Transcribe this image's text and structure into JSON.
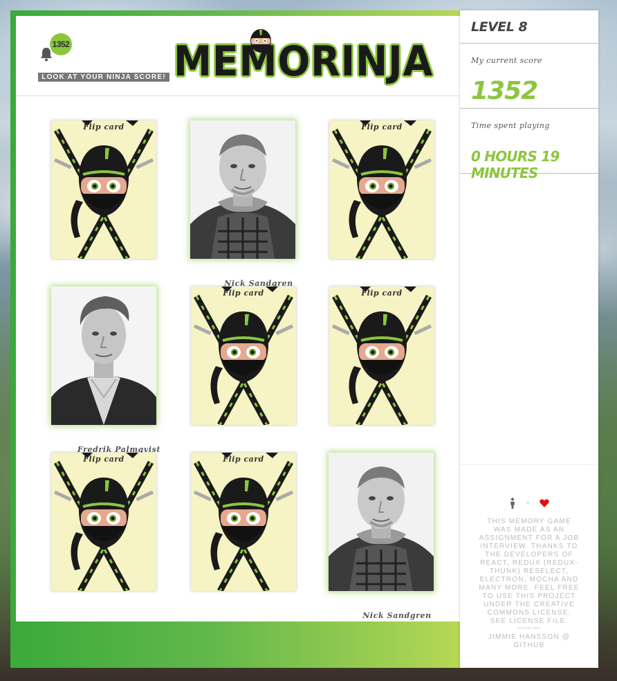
{
  "header": {
    "notification_count": "1352",
    "score_link": "LOOK AT YOUR NINJA SCORE!",
    "logo_text": "MEMORINJA"
  },
  "cards": [
    {
      "state": "hidden",
      "label": "Flip card"
    },
    {
      "state": "revealed",
      "name": "Nick Sandgren"
    },
    {
      "state": "hidden",
      "label": "Flip card"
    },
    {
      "state": "revealed",
      "name": "Fredrik Palmqvist"
    },
    {
      "state": "hidden",
      "label": "Flip card"
    },
    {
      "state": "hidden",
      "label": "Flip card"
    },
    {
      "state": "hidden",
      "label": "Flip card"
    },
    {
      "state": "hidden",
      "label": "Flip card"
    },
    {
      "state": "revealed",
      "name": "Nick Sandgren"
    }
  ],
  "sidebar": {
    "level": "LEVEL 8",
    "score_caption": "My current score",
    "score_value": "1352",
    "time_caption": "Time spent playing",
    "time_value": "0 HOURS 19 MINUTES",
    "credits_text": "This memory game was made as an assignment for a job interview. Thanks to the developers of React, Redux (Redux-Thunk) Reselect, Electron, Mocha and many more. Feel free to use this project under the Creative Commons License. See LICENSE file.",
    "credits_divider": "———",
    "credits_author": "Jimmie Hansson @ GitHub",
    "plus": "+"
  },
  "colors": {
    "accent": "#8cc63f",
    "card_back": "#f6f3c4"
  },
  "icons": [
    "bell-icon",
    "person-icon",
    "heart-icon"
  ]
}
